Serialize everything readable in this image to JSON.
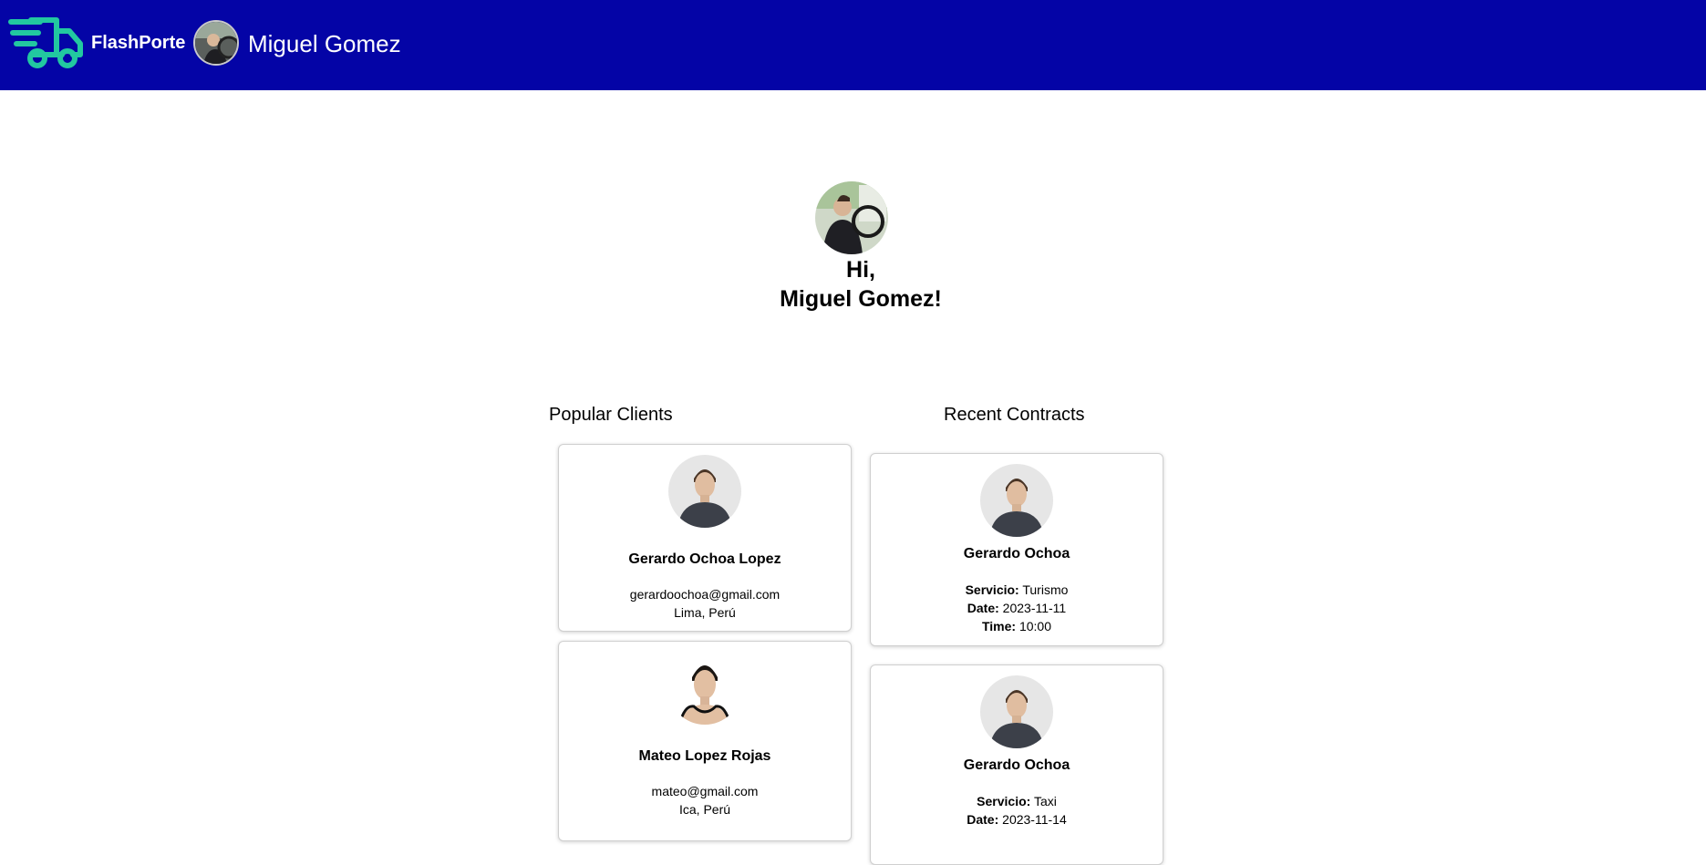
{
  "header": {
    "brand": "FlashPorte",
    "user_name": "Miguel Gomez",
    "brand_color": "#0404a6",
    "logo_color": "#22c8a0"
  },
  "hero": {
    "greeting_line1": "Hi,",
    "greeting_line2": "Miguel Gomez!"
  },
  "popular_clients": {
    "title": "Popular Clients",
    "items": [
      {
        "name": "Gerardo Ochoa Lopez",
        "email": "gerardoochoa@gmail.com",
        "location": "Lima, Perú"
      },
      {
        "name": "Mateo Lopez Rojas",
        "email": "mateo@gmail.com",
        "location": "Ica, Perú"
      }
    ]
  },
  "recent_contracts": {
    "title": "Recent Contracts",
    "service_label": "Servicio:",
    "date_label": "Date:",
    "time_label": "Time:",
    "items": [
      {
        "name": "Gerardo Ochoa",
        "service": "Turismo",
        "date": "2023-11-11",
        "time": "10:00"
      },
      {
        "name": "Gerardo Ochoa",
        "service": "Taxi",
        "date": "2023-11-14"
      }
    ]
  }
}
